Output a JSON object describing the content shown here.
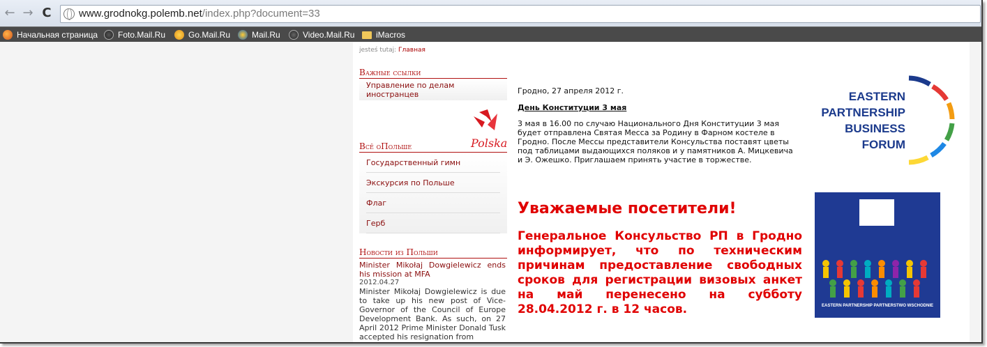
{
  "browser": {
    "url_host": "www.grodnokg.polemb.net",
    "url_path": "/index.php?document=33",
    "back_icon": "←",
    "forward_icon": "→",
    "reload_icon": "C"
  },
  "bookmarks": [
    {
      "label": "Начальная страница",
      "icon": "firefox-icon"
    },
    {
      "label": "Foto.Mail.Ru",
      "icon": "foto-mail-icon"
    },
    {
      "label": "Go.Mail.Ru",
      "icon": "go-mail-icon"
    },
    {
      "label": "Mail.Ru",
      "icon": "mail-ru-icon"
    },
    {
      "label": "Video.Mail.Ru",
      "icon": "video-mail-icon"
    },
    {
      "label": "iMacros",
      "icon": "folder-icon"
    }
  ],
  "breadcrumb": {
    "prefix": "jesteś tutaj:",
    "current": "Главная"
  },
  "sidebar": {
    "links_heading": "Важные ссылки",
    "links": [
      "Управление по делам иностранцев"
    ],
    "logo_text": "Polska",
    "about_heading": "Всё оПольше",
    "about_items": [
      "Государственный гимн",
      "Экскурсия по Польше",
      "Флаг",
      "Герб"
    ],
    "news_heading": "Новости из Польши",
    "news_title": "Minister Mikołaj Dowgielewicz ends his mission at MFA",
    "news_date": "2012.04.27",
    "news_body": "Minister Mikołaj Dowgielewicz is due to take up his new post of Vice-Governor of the Council of Europe Development Bank. As such, on 27 April 2012 Prime Minister Donald Tusk accepted his resignation from"
  },
  "main": {
    "date_line": "Гродно, 27 апреля 2012 г.",
    "headline": "День Конституции 3 мая",
    "paragraph": "3 мая в 16.00 по случаю Национального Дня Конституции 3 мая будет отправлена Святая Месса за Родину в Фарном костеле в Гродно. После Мессы представители Консульства поставят цветы под таблицами выдающихся поляков и у памятников А. Мицкевича и Э. Ожешко. Приглашаем принять участие в торжестве.",
    "notice_title": "Уважаемые посетители!",
    "notice_body": "Генеральное Консульство РП в Гродно информирует, что по техническим причинам предоставление свободных сроков для регистрации визовых анкет на май перенесено на субботу 28.04.2012 г. в 12 часов."
  },
  "banners": {
    "epbf_lines": [
      "EASTERN",
      "PARTNERSHIP",
      "BUSINESS",
      "FORUM"
    ],
    "poster_caption": "EASTERN PARTNERSHIP PARTNERSTWO WSCHODNIE"
  }
}
